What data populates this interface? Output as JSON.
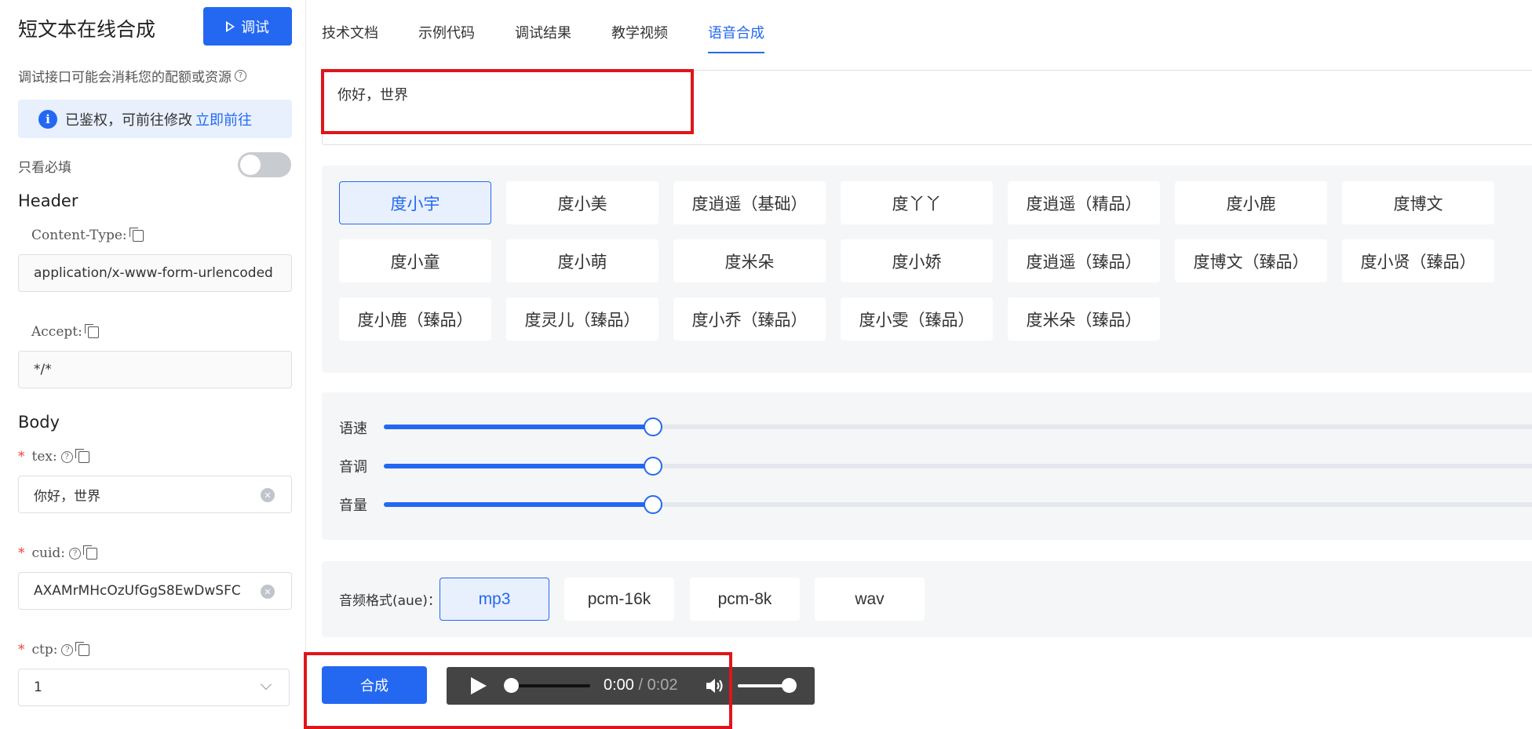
{
  "left": {
    "title": "短文本在线合成",
    "debug_button": "调试",
    "warning": "调试接口可能会消耗您的配额或资源",
    "auth": {
      "text": "已鉴权，可前往修改",
      "link": "立即前往"
    },
    "required_only": "只看必填",
    "header_section": "Header",
    "content_type": {
      "label": "Content-Type:",
      "value": "application/x-www-form-urlencoded"
    },
    "accept": {
      "label": "Accept:",
      "value": "*/*"
    },
    "body_section": "Body",
    "tex": {
      "label": "tex:",
      "value": "你好，世界"
    },
    "cuid": {
      "label": "cuid:",
      "value": "AXAMrMHcOzUfGgS8EwDwSFC"
    },
    "ctp": {
      "label": "ctp:",
      "value": "1"
    }
  },
  "tabs": [
    {
      "label": "技术文档"
    },
    {
      "label": "示例代码"
    },
    {
      "label": "调试结果"
    },
    {
      "label": "教学视频"
    },
    {
      "label": "语音合成"
    }
  ],
  "text_input": "你好，世界",
  "voices": [
    {
      "label": "度小宇",
      "selected": true
    },
    {
      "label": "度小美"
    },
    {
      "label": "度逍遥（基础）"
    },
    {
      "label": "度丫丫"
    },
    {
      "label": "度逍遥（精品）"
    },
    {
      "label": "度小鹿"
    },
    {
      "label": "度博文"
    },
    {
      "label": "度小童"
    },
    {
      "label": "度小萌"
    },
    {
      "label": "度米朵"
    },
    {
      "label": "度小娇"
    },
    {
      "label": "度逍遥（臻品）"
    },
    {
      "label": "度博文（臻品）"
    },
    {
      "label": "度小贤（臻品）"
    },
    {
      "label": "度小鹿（臻品）"
    },
    {
      "label": "度灵儿（臻品）"
    },
    {
      "label": "度小乔（臻品）"
    },
    {
      "label": "度小雯（臻品）"
    },
    {
      "label": "度米朵（臻品）"
    }
  ],
  "sliders": {
    "speed": {
      "label": "语速",
      "fraction": 0.233
    },
    "pitch": {
      "label": "音调",
      "fraction": 0.233
    },
    "volume": {
      "label": "音量",
      "fraction": 0.233
    }
  },
  "format": {
    "label": "音频格式(aue)：",
    "options": [
      "mp3",
      "pcm-16k",
      "pcm-8k",
      "wav"
    ],
    "selected": "mp3"
  },
  "synth_button": "合成",
  "player": {
    "current": "0:00",
    "separator": " / ",
    "duration": "0:02",
    "progress_fraction": 0,
    "volume_fraction": 1
  },
  "colors": {
    "accent": "#2468f2",
    "highlight_box": "#e0151a"
  }
}
